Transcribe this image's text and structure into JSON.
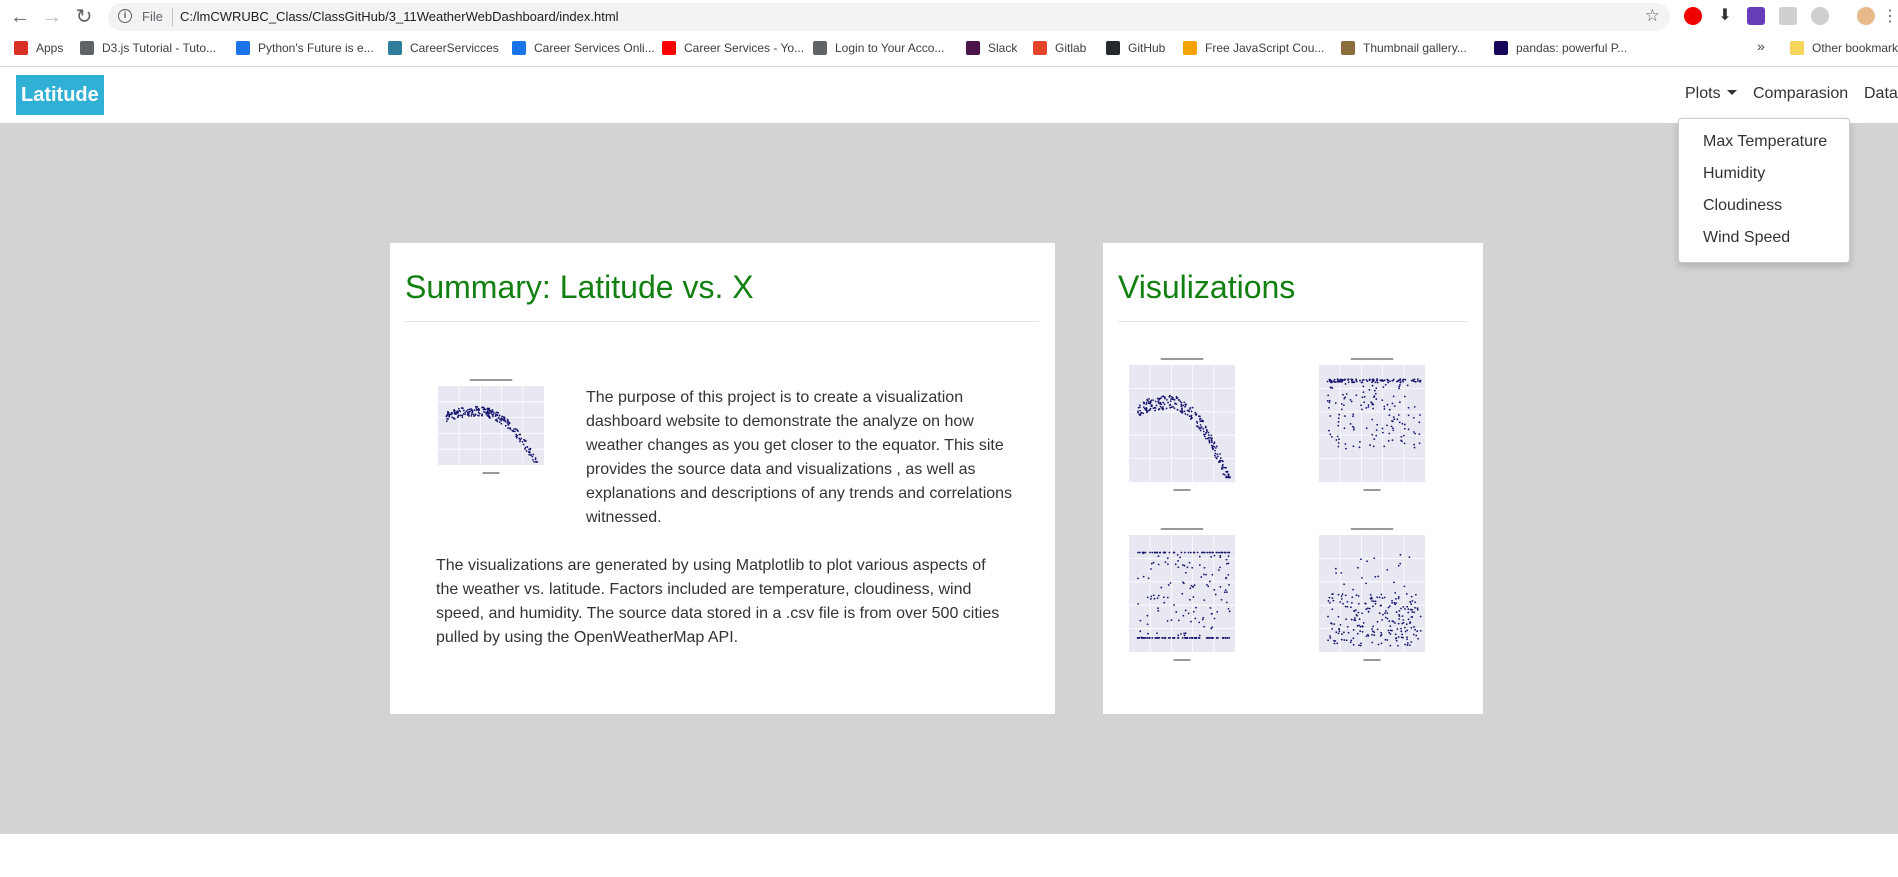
{
  "browser": {
    "file_label": "File",
    "url": "C:/lmCWRUBC_Class/ClassGitHub/3_11WeatherWebDashboard/index.html",
    "bookmarks": [
      {
        "label": "Apps",
        "icon": "apps-grid-icon",
        "color": "#d93025"
      },
      {
        "label": "D3.js Tutorial - Tuto...",
        "icon": "d3-icon",
        "color": "#5f6368"
      },
      {
        "label": "Python's Future is e...",
        "icon": "python-icon",
        "color": "#1a73e8"
      },
      {
        "label": "CareerServicces",
        "icon": "career-icon",
        "color": "#2e7d9a"
      },
      {
        "label": "Career Services Onli...",
        "icon": "cs-icon",
        "color": "#1a73e8"
      },
      {
        "label": "Career Services - Yo...",
        "icon": "youtube-icon",
        "color": "#ff0000"
      },
      {
        "label": "Login to Your Acco...",
        "icon": "globe-icon",
        "color": "#5f6368"
      },
      {
        "label": "Slack",
        "icon": "slack-icon",
        "color": "#4a154b"
      },
      {
        "label": "Gitlab",
        "icon": "gitlab-icon",
        "color": "#e24329"
      },
      {
        "label": "GitHub",
        "icon": "github-icon",
        "color": "#24292e"
      },
      {
        "label": "Free JavaScript Cou...",
        "icon": "js-course-icon",
        "color": "#f4a300"
      },
      {
        "label": "Thumbnail gallery...",
        "icon": "matplotlib-icon",
        "color": "#8a6d3b"
      },
      {
        "label": "pandas: powerful P...",
        "icon": "pandas-icon",
        "color": "#150458"
      }
    ],
    "more_label": "»",
    "other_bookmarks": "Other bookmarks"
  },
  "navbar": {
    "brand": "Latitude",
    "links": {
      "plots": "Plots",
      "comparison": "Comparasion",
      "data": "Data"
    },
    "dropdown": [
      "Max Temperature",
      "Humidity",
      "Cloudiness",
      "Wind Speed"
    ]
  },
  "summary": {
    "title": "Summary: Latitude vs. X",
    "paragraph1": "The purpose of this project is to create a visualization dashboard website to demonstrate the analyze on how weather changes as you get closer to the equator. This site provides the source data and visualizations , as well as explanations and descriptions of any trends and correlations witnessed.",
    "paragraph2": "The visualizations are generated by using Matplotlib to plot various aspects of the weather vs. latitude. Factors included are temperature, cloudiness, wind speed, and humidity. The source data stored in a .csv file is from over 500 cities pulled by using the OpenWeatherMap API."
  },
  "visualizations": {
    "title": "Visulizations"
  },
  "colors": {
    "brand_bg": "#31b0d5",
    "heading": "#118011",
    "content_bg": "#d3d3d3",
    "plot_bg": "#e8e8f2",
    "point": "#15156e"
  }
}
